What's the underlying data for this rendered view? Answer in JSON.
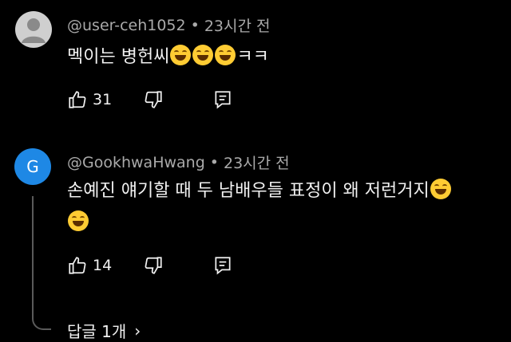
{
  "comments": [
    {
      "handle": "@user-ceh1052",
      "separator": "•",
      "time": "23시간 전",
      "avatar_icon": "default-user-avatar-icon",
      "text": "멕이는 병헌씨",
      "text_suffix": "ㅋㅋ",
      "emojis": [
        "grinning-face-icon",
        "grinning-face-icon",
        "grinning-face-icon"
      ],
      "like_count": "31"
    },
    {
      "handle": "@GookhwaHwang",
      "separator": "•",
      "time": "23시간 전",
      "avatar_letter": "G",
      "avatar_color": "#1e88e5",
      "text_line1": "손예진 얘기할 때 두 남배우들 표정이 왜 저런거지",
      "emojis": [
        "grinning-face-icon",
        "grinning-face-icon"
      ],
      "like_count": "14",
      "replies_label": "답글 1개",
      "replies_chevron": "›"
    }
  ],
  "colors": {
    "background": "#000000",
    "meta": "#aaaaaa",
    "text": "#f1f1f1",
    "thread_line": "#5a5a5a"
  }
}
